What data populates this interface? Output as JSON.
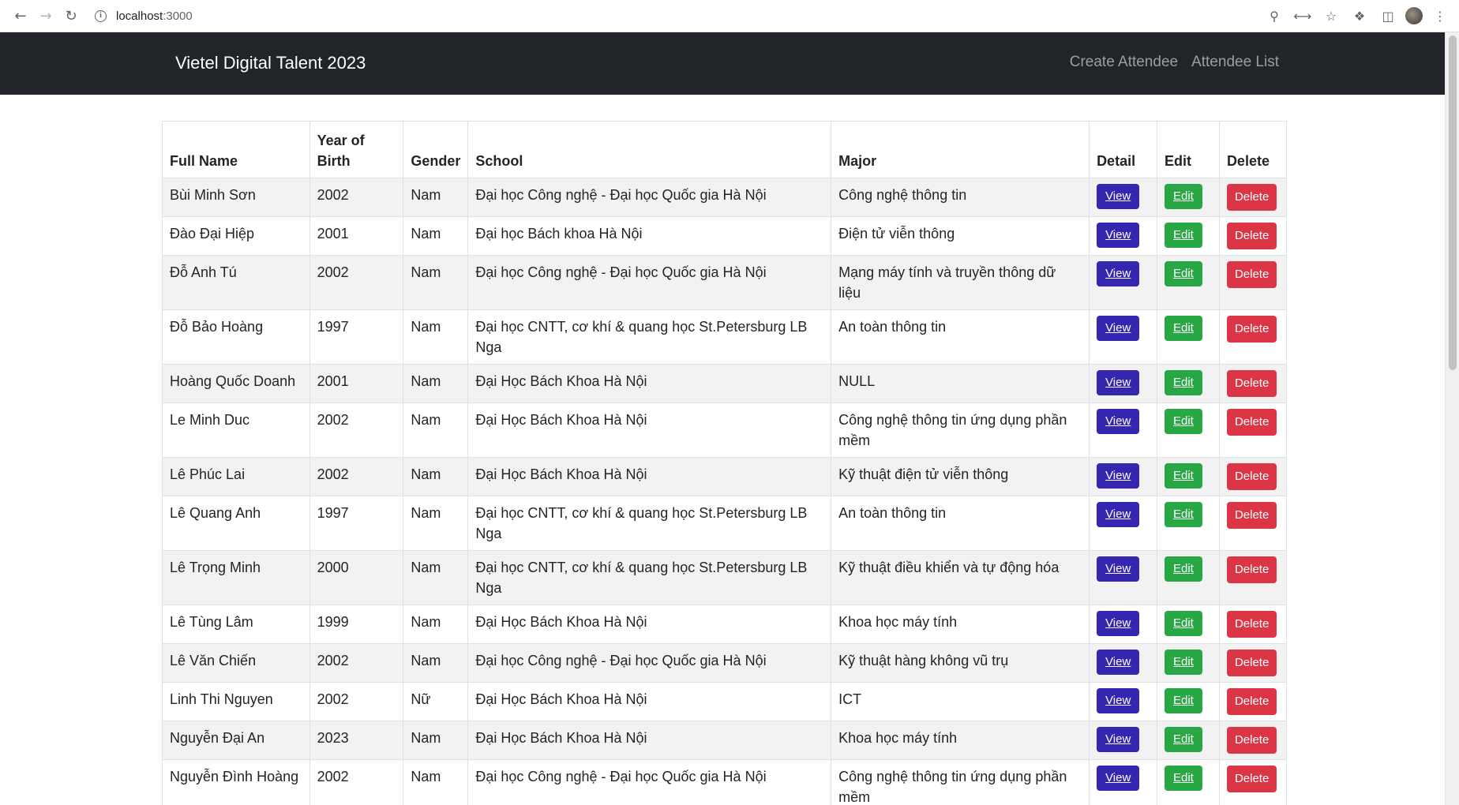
{
  "browser": {
    "url_host": "localhost",
    "url_port": ":3000"
  },
  "navbar": {
    "brand": "Vietel Digital Talent 2023",
    "links": [
      "Create Attendee",
      "Attendee List"
    ]
  },
  "table": {
    "headers": [
      "Full Name",
      "Year of Birth",
      "Gender",
      "School",
      "Major",
      "Detail",
      "Edit",
      "Delete"
    ],
    "action_labels": {
      "view": "View",
      "edit": "Edit",
      "delete": "Delete"
    },
    "rows": [
      [
        "Bùi Minh Sơn",
        "2002",
        "Nam",
        "Đại học Công nghệ - Đại học Quốc gia Hà Nội",
        "Công nghệ thông tin"
      ],
      [
        "Đào Đại Hiệp",
        "2001",
        "Nam",
        "Đại học Bách khoa Hà Nội",
        "Điện tử viễn thông"
      ],
      [
        "Đỗ Anh Tú",
        "2002",
        "Nam",
        "Đại học Công nghệ - Đại học Quốc gia Hà Nội",
        "Mạng máy tính và truyền thông dữ liệu"
      ],
      [
        "Đỗ Bảo Hoàng",
        "1997",
        "Nam",
        "Đại học CNTT, cơ khí & quang học St.Petersburg LB Nga",
        "An toàn thông tin"
      ],
      [
        "Hoàng Quốc Doanh",
        "2001",
        "Nam",
        "Đại Học Bách Khoa Hà Nội",
        "NULL"
      ],
      [
        "Le Minh Duc",
        "2002",
        "Nam",
        "Đại Học Bách Khoa Hà Nội",
        "Công nghệ thông tin ứng dụng phần mềm"
      ],
      [
        "Lê Phúc Lai",
        "2002",
        "Nam",
        "Đại Học Bách Khoa Hà Nội",
        "Kỹ thuật điện tử viễn thông"
      ],
      [
        "Lê Quang Anh",
        "1997",
        "Nam",
        "Đại học CNTT, cơ khí & quang học St.Petersburg LB Nga",
        "An toàn thông tin"
      ],
      [
        "Lê Trọng Minh",
        "2000",
        "Nam",
        "Đại học CNTT, cơ khí & quang học St.Petersburg LB Nga",
        "Kỹ thuật điều khiển và tự động hóa"
      ],
      [
        "Lê Tùng Lâm",
        "1999",
        "Nam",
        "Đại Học Bách Khoa Hà Nội",
        "Khoa học máy tính"
      ],
      [
        "Lê Văn Chiến",
        "2002",
        "Nam",
        "Đại học Công nghệ - Đại học Quốc gia Hà Nội",
        "Kỹ thuật hàng không vũ trụ"
      ],
      [
        "Linh Thi Nguyen",
        "2002",
        "Nữ",
        "Đại Học Bách Khoa Hà Nội",
        "ICT"
      ],
      [
        "Nguyễn Đại An",
        "2023",
        "Nam",
        "Đại Học Bách Khoa Hà Nội",
        "Khoa học máy tính"
      ],
      [
        "Nguyễn Đình Hoàng",
        "2002",
        "Nam",
        "Đại học Công nghệ - Đại học Quốc gia Hà Nội",
        "Công nghệ thông tin ứng dụng phần mềm"
      ]
    ]
  }
}
